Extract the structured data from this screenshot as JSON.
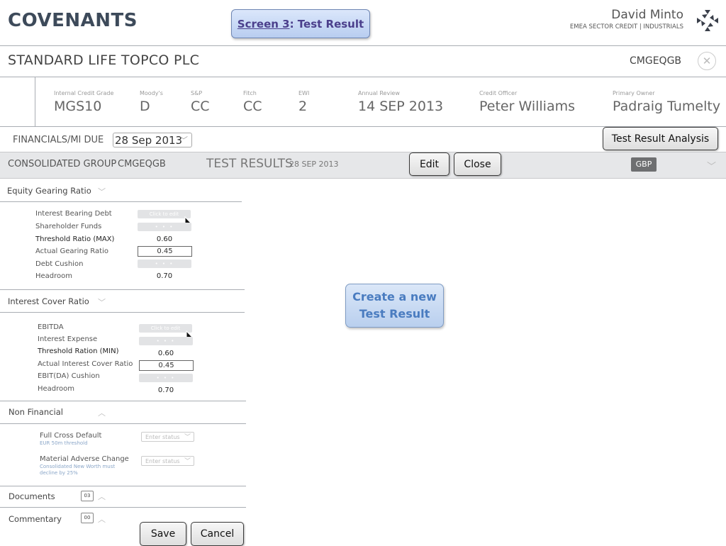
{
  "header": {
    "app_title": "COVENANTS",
    "screen_ref": "Screen 3",
    "screen_name": ": Test Result",
    "user_name": "David Minto",
    "user_dept": "EMEA SECTOR CREDIT | INDUSTRIALS",
    "logo_icon": "bank-logo"
  },
  "company": {
    "name": "STANDARD LIFE TOPCO PLC",
    "code": "CMGEQGB",
    "close_icon": "close-circle-icon"
  },
  "ratings": [
    {
      "label": "Internal Credit Grade",
      "value": "MGS10"
    },
    {
      "label": "Moody's",
      "value": "D"
    },
    {
      "label": "S&P",
      "value": "CC"
    },
    {
      "label": "Fitch",
      "value": "CC"
    },
    {
      "label": "EWI",
      "value": "2"
    },
    {
      "label": "Annual Review",
      "value": "14 SEP 2013"
    },
    {
      "label": "Credit Officer",
      "value": "Peter Williams"
    },
    {
      "label": "Primary Owner",
      "value": "Padraig Tumelty"
    }
  ],
  "financials": {
    "label": "FINANCIALS/MI DUE",
    "selected": "28 Sep 2013",
    "analysis_button": "Test Result Analysis"
  },
  "bar": {
    "group_label": "CONSOLIDATED GROUP",
    "group_code": "CMGEQGB",
    "section_title": "TEST RESULTS",
    "section_date": "28 SEP 2013",
    "edit_button": "Edit",
    "close_button": "Close",
    "currency": "GBP"
  },
  "equity_gearing": {
    "title": "Equity Gearing Ratio",
    "rows": {
      "interest_bearing_debt": {
        "label": "Interest Bearing Debt",
        "value": "Click to edit"
      },
      "shareholder_funds": {
        "label": "Shareholder Funds",
        "value": "• • •"
      },
      "threshold": {
        "label": "Threshold Ratio (MAX)",
        "value": "0.60"
      },
      "actual": {
        "label": "Actual Gearing Ratio",
        "value": "0.45"
      },
      "cushion": {
        "label": "Debt Cushion",
        "value": "• • •"
      },
      "headroom": {
        "label": "Headroom",
        "value": "0.70"
      }
    }
  },
  "interest_cover": {
    "title": "Interest Cover Ratio",
    "rows": {
      "ebitda": {
        "label": "EBITDA",
        "value": "Click to edit"
      },
      "interest_expense": {
        "label": "Interest Expense",
        "value": "• • •"
      },
      "threshold": {
        "label": "Threshold Ration (MIN)",
        "value": "0.60"
      },
      "actual": {
        "label": "Actual Interest Cover Ratio",
        "value": "0.45"
      },
      "cushion": {
        "label": "EBIT(DA) Cushion",
        "value": "• • •"
      },
      "headroom": {
        "label": "Headroom",
        "value": "0.70"
      }
    }
  },
  "non_financial": {
    "title": "Non Financial",
    "items": [
      {
        "label": "Full Cross Default",
        "note": "EUR 50m threshold",
        "status": "Enter status"
      },
      {
        "label": "Material Adverse Change",
        "note": "Consolidated New Worth must decline by 25%",
        "status": "Enter status"
      }
    ]
  },
  "documents": {
    "title": "Documents",
    "count": "03"
  },
  "commentary": {
    "title": "Commentary",
    "count": "00"
  },
  "callout": {
    "line1": "Create a new",
    "line2": "Test Result"
  },
  "footer": {
    "save": "Save",
    "cancel": "Cancel"
  }
}
